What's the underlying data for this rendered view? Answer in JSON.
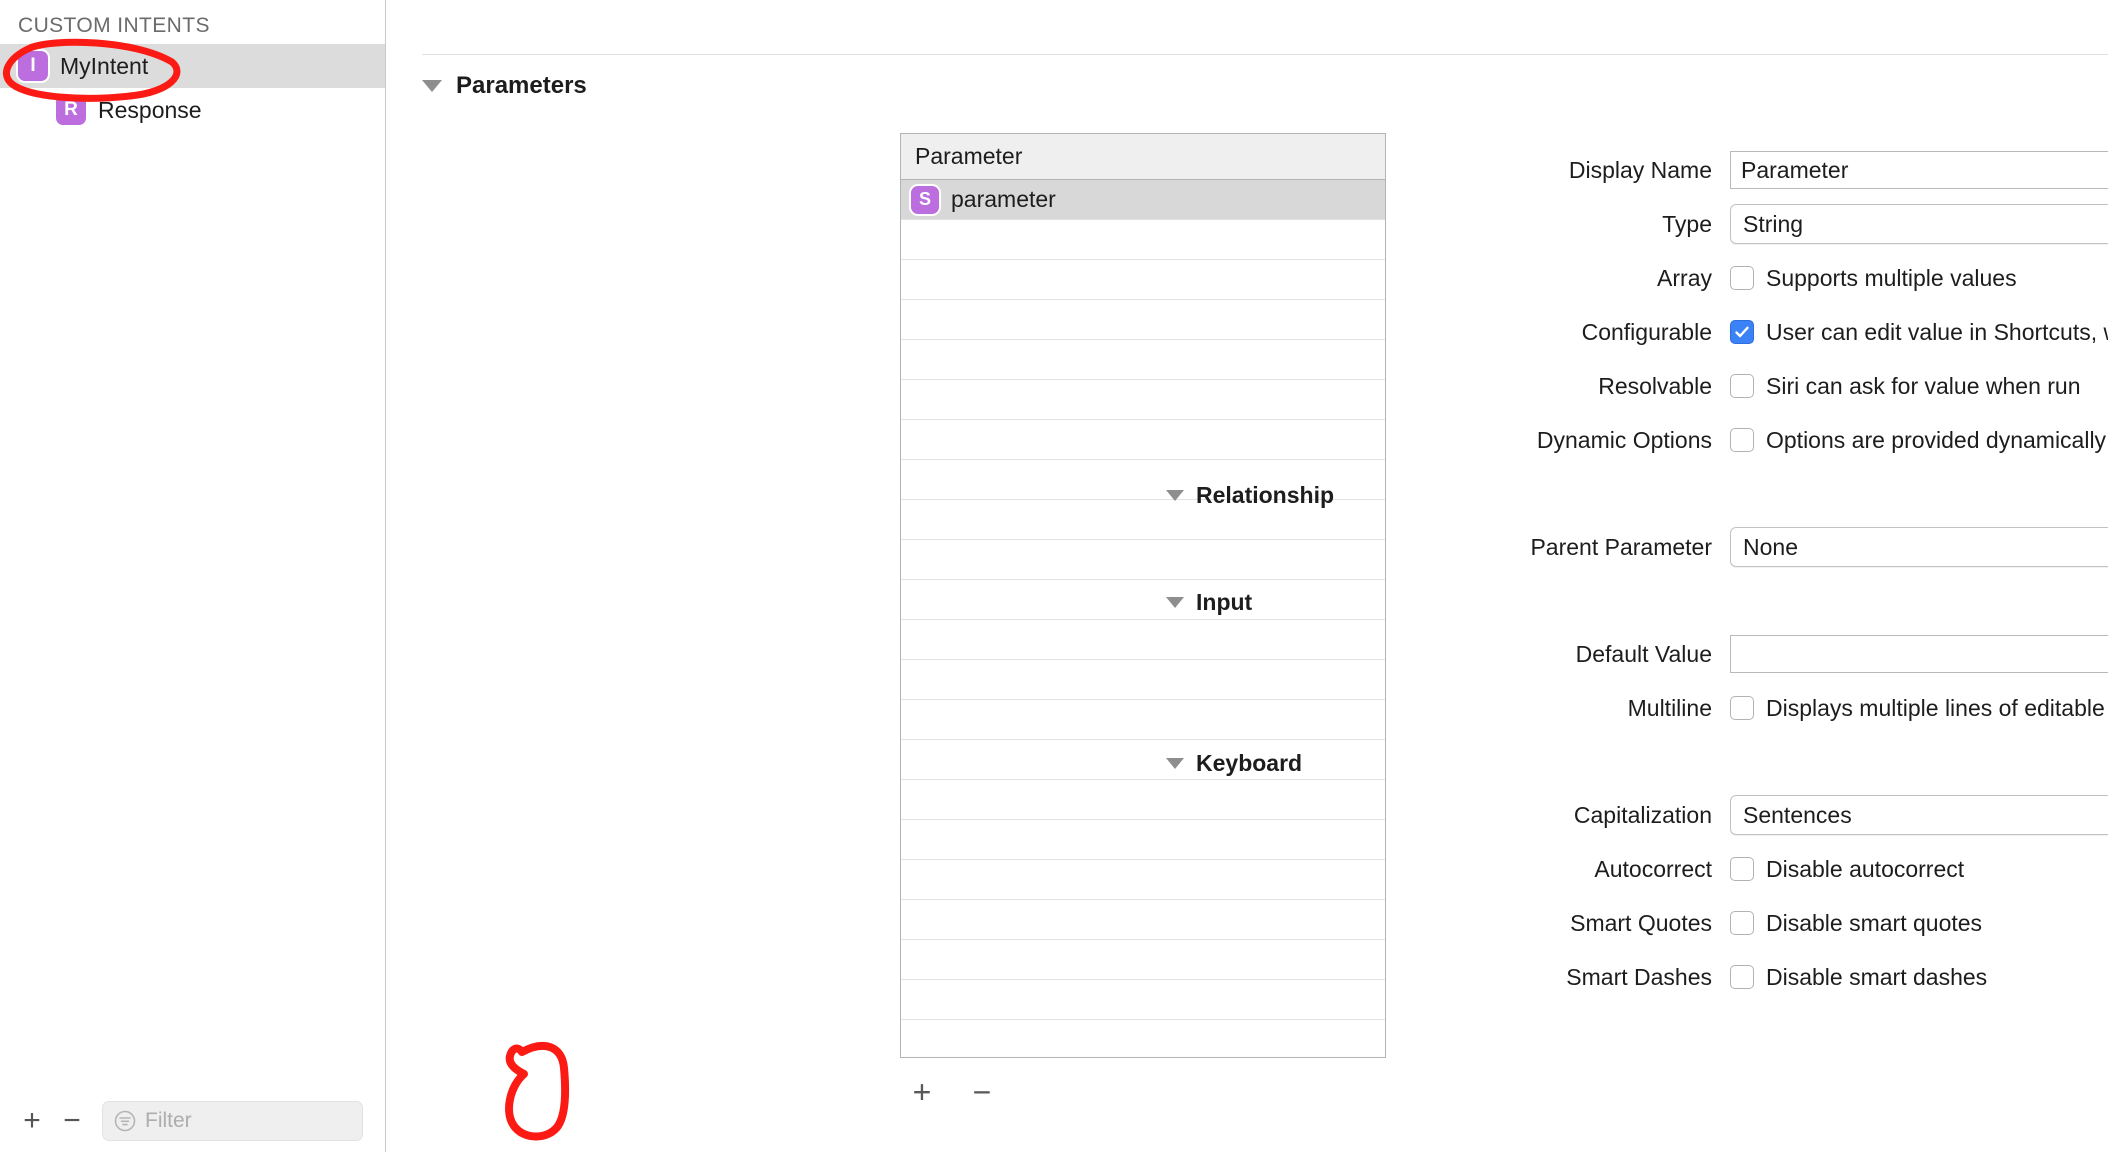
{
  "sidebar": {
    "section_header": "CUSTOM INTENTS",
    "items": [
      {
        "label": "MyIntent",
        "badge": "I",
        "selected": true,
        "child": false
      },
      {
        "label": "Response",
        "badge": "R",
        "selected": false,
        "child": true
      }
    ],
    "toolbar": {
      "add_label": "+",
      "remove_label": "−",
      "filter_placeholder": "Filter",
      "filter_value": "",
      "filter_icon": "filter-icon"
    }
  },
  "main": {
    "section": {
      "title": "Parameters",
      "disclosure": "triangle-down-icon"
    },
    "table": {
      "column_header": "Parameter",
      "rows": [
        {
          "label": "parameter",
          "badge": "S",
          "selected": true
        }
      ],
      "empty_row_count": 23
    },
    "table_toolbar": {
      "add_label": "+",
      "remove_label": "−"
    },
    "form": {
      "fields": [
        {
          "label": "Display Name",
          "kind": "text",
          "value": "Parameter"
        },
        {
          "label": "Type",
          "kind": "select",
          "value": "String"
        },
        {
          "label": "Array",
          "kind": "checkbox",
          "checked": false,
          "text": "Supports multiple values"
        },
        {
          "label": "Configurable",
          "kind": "checkbox",
          "checked": true,
          "text": "User can edit value in Shortcuts, widgets, and Add to Siri"
        },
        {
          "label": "Resolvable",
          "kind": "checkbox",
          "checked": false,
          "text": "Siri can ask for value when run"
        },
        {
          "label": "Dynamic Options",
          "kind": "checkbox",
          "checked": false,
          "text": "Options are provided dynamically"
        }
      ],
      "relationship": {
        "title": "Relationship",
        "fields": [
          {
            "label": "Parent Parameter",
            "kind": "select",
            "value": "None"
          }
        ]
      },
      "input": {
        "title": "Input",
        "fields": [
          {
            "label": "Default Value",
            "kind": "text",
            "value": ""
          },
          {
            "label": "Multiline",
            "kind": "checkbox",
            "checked": false,
            "text": "Displays multiple lines of editable text"
          }
        ]
      },
      "keyboard": {
        "title": "Keyboard",
        "fields": [
          {
            "label": "Capitalization",
            "kind": "select",
            "value": "Sentences"
          },
          {
            "label": "Autocorrect",
            "kind": "checkbox",
            "checked": false,
            "text": "Disable autocorrect"
          },
          {
            "label": "Smart Quotes",
            "kind": "checkbox",
            "checked": false,
            "text": "Disable smart quotes"
          },
          {
            "label": "Smart Dashes",
            "kind": "checkbox",
            "checked": false,
            "text": "Disable smart dashes"
          }
        ]
      }
    }
  },
  "annotations": {
    "color": "#fb1b14",
    "items": [
      {
        "name": "sidebar-myintent-highlight"
      },
      {
        "name": "add-parameter-highlight"
      }
    ]
  }
}
